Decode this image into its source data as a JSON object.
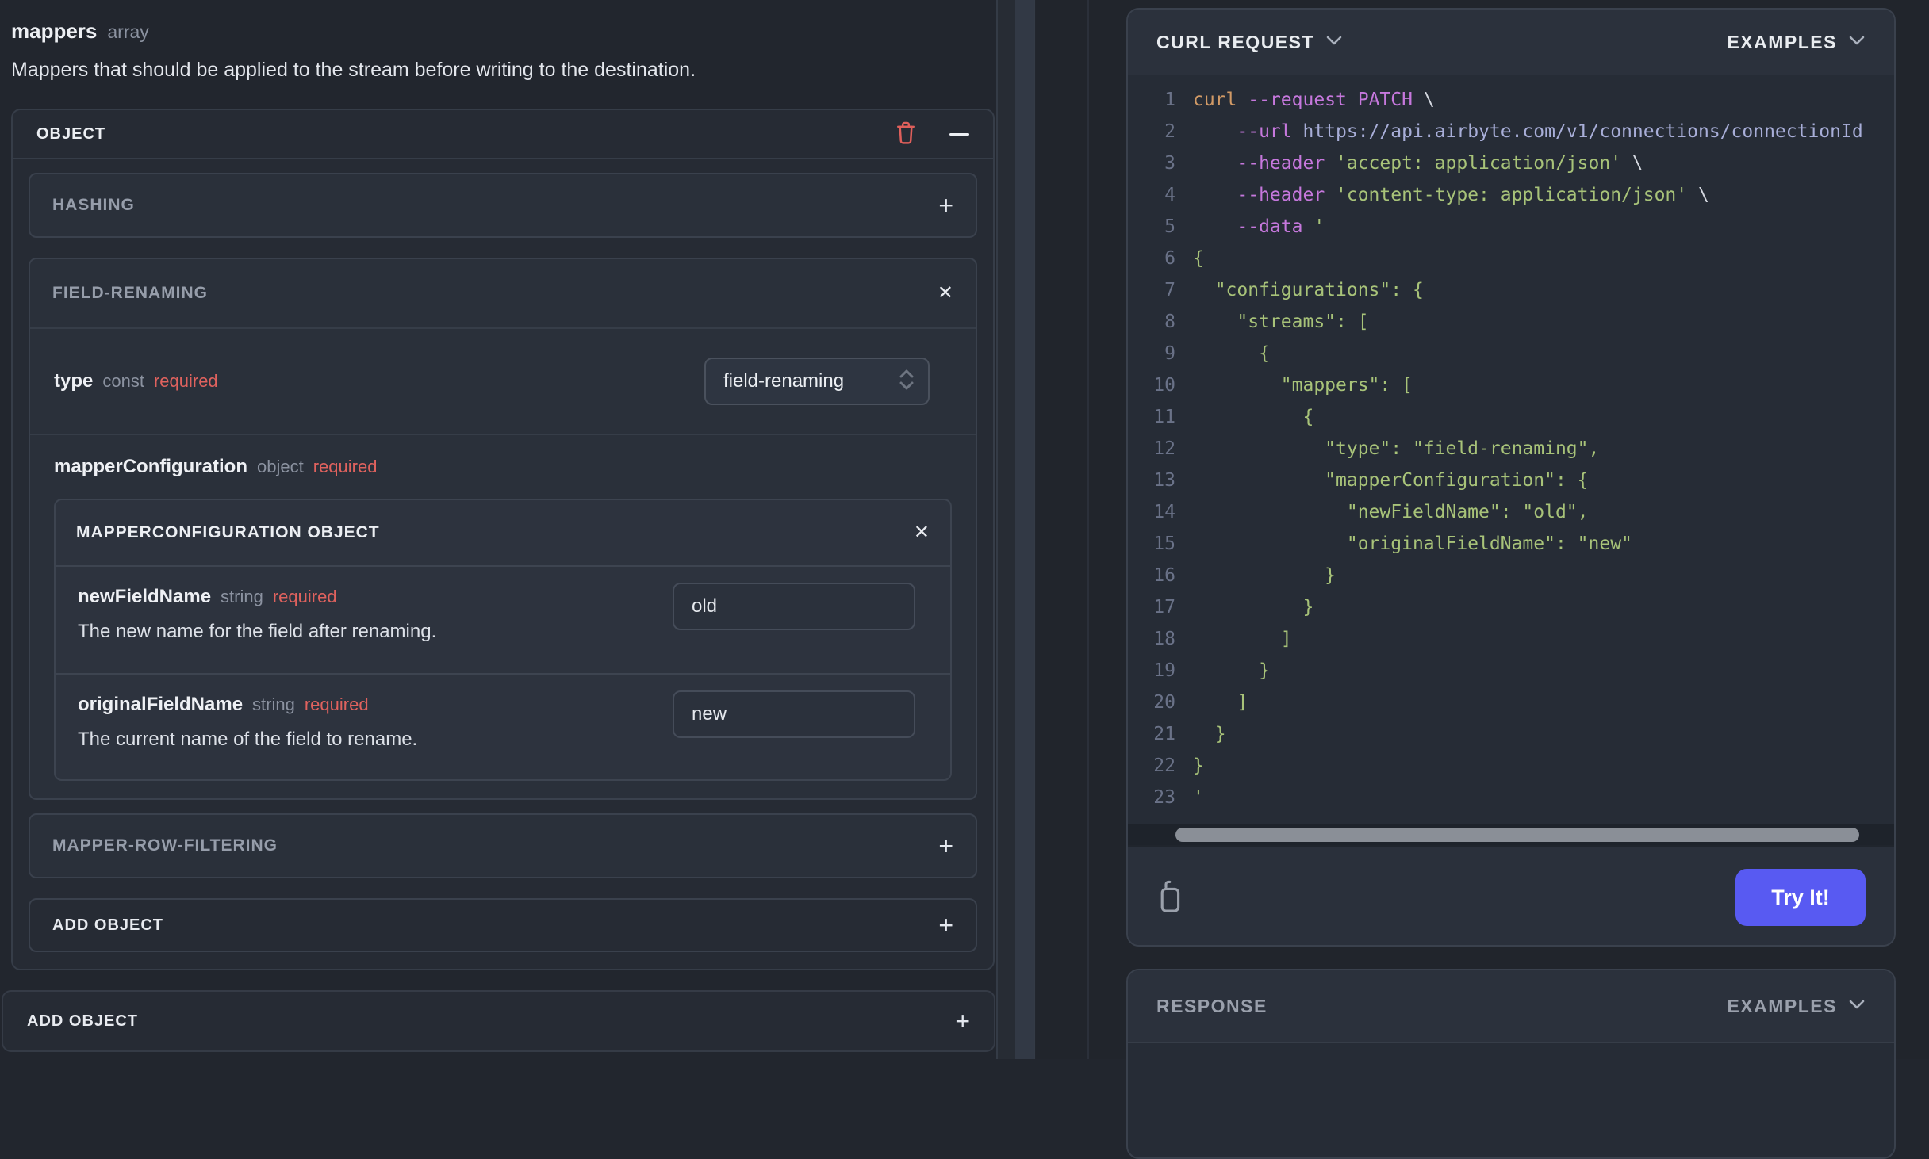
{
  "left": {
    "field_name": "mappers",
    "field_type": "array",
    "description": "Mappers that should be applied to the stream before writing to the destination.",
    "object_card": {
      "header": "OBJECT",
      "hashing": {
        "label": "HASHING"
      },
      "field_renaming": {
        "label": "FIELD-RENAMING",
        "type_row": {
          "name": "type",
          "kind": "const",
          "required": "required",
          "value": "field-renaming"
        },
        "mapper_configuration": {
          "name": "mapperConfiguration",
          "kind": "object",
          "required": "required",
          "card": {
            "header": "MAPPERCONFIGURATION OBJECT",
            "fields": [
              {
                "name": "newFieldName",
                "kind": "string",
                "required": "required",
                "value": "old",
                "description": "The new name for the field after renaming."
              },
              {
                "name": "originalFieldName",
                "kind": "string",
                "required": "required",
                "value": "new",
                "description": "The current name of the field to rename."
              }
            ]
          }
        }
      },
      "mapper_row_filtering": {
        "label": "MAPPER-ROW-FILTERING"
      },
      "add_object": {
        "label": "ADD OBJECT"
      }
    },
    "add_object_bottom": {
      "label": "ADD OBJECT"
    }
  },
  "right": {
    "curl_panel": {
      "title": "CURL REQUEST",
      "examples_label": "EXAMPLES",
      "try_button": "Try It!",
      "code_lines": [
        {
          "n": 1,
          "segs": [
            [
              "k",
              "curl "
            ],
            [
              "f",
              "--request PATCH"
            ],
            [
              "w",
              " \\"
            ]
          ]
        },
        {
          "n": 2,
          "segs": [
            [
              "f",
              "    --url "
            ],
            [
              "u",
              "https://api.airbyte.com/v1/connections/connectionId"
            ]
          ]
        },
        {
          "n": 3,
          "segs": [
            [
              "f",
              "    --header "
            ],
            [
              "s",
              "'accept: application/json'"
            ],
            [
              "w",
              " \\"
            ]
          ]
        },
        {
          "n": 4,
          "segs": [
            [
              "f",
              "    --header "
            ],
            [
              "s",
              "'content-type: application/json'"
            ],
            [
              "w",
              " \\"
            ]
          ]
        },
        {
          "n": 5,
          "segs": [
            [
              "f",
              "    --data "
            ],
            [
              "s",
              "'"
            ]
          ]
        },
        {
          "n": 6,
          "segs": [
            [
              "s",
              "{"
            ]
          ]
        },
        {
          "n": 7,
          "segs": [
            [
              "s",
              "  \"configurations\": {"
            ]
          ]
        },
        {
          "n": 8,
          "segs": [
            [
              "s",
              "    \"streams\": ["
            ]
          ]
        },
        {
          "n": 9,
          "segs": [
            [
              "s",
              "      {"
            ]
          ]
        },
        {
          "n": 10,
          "segs": [
            [
              "s",
              "        \"mappers\": ["
            ]
          ]
        },
        {
          "n": 11,
          "segs": [
            [
              "s",
              "          {"
            ]
          ]
        },
        {
          "n": 12,
          "segs": [
            [
              "s",
              "            \"type\": \"field-renaming\","
            ]
          ]
        },
        {
          "n": 13,
          "segs": [
            [
              "s",
              "            \"mapperConfiguration\": {"
            ]
          ]
        },
        {
          "n": 14,
          "segs": [
            [
              "s",
              "              \"newFieldName\": \"old\","
            ]
          ]
        },
        {
          "n": 15,
          "segs": [
            [
              "s",
              "              \"originalFieldName\": \"new\""
            ]
          ]
        },
        {
          "n": 16,
          "segs": [
            [
              "s",
              "            }"
            ]
          ]
        },
        {
          "n": 17,
          "segs": [
            [
              "s",
              "          }"
            ]
          ]
        },
        {
          "n": 18,
          "segs": [
            [
              "s",
              "        ]"
            ]
          ]
        },
        {
          "n": 19,
          "segs": [
            [
              "s",
              "      }"
            ]
          ]
        },
        {
          "n": 20,
          "segs": [
            [
              "s",
              "    ]"
            ]
          ]
        },
        {
          "n": 21,
          "segs": [
            [
              "s",
              "  }"
            ]
          ]
        },
        {
          "n": 22,
          "segs": [
            [
              "s",
              "}"
            ]
          ]
        },
        {
          "n": 23,
          "segs": [
            [
              "s",
              "'"
            ]
          ]
        }
      ]
    },
    "response_panel": {
      "title": "RESPONSE",
      "examples_label": "EXAMPLES"
    }
  },
  "icons": {
    "plus": "+",
    "close": "✕"
  },
  "colors": {
    "page_bg": "#22262e",
    "card_bg": "#262b34",
    "subcard_bg": "#2a303a",
    "required_red": "#e0625e",
    "accent_button": "#585af2",
    "code_green": "#a8c379",
    "code_purple": "#c678dd",
    "code_orange": "#d19a66",
    "code_url": "#a8aed8",
    "line_number": "#6a7288"
  }
}
